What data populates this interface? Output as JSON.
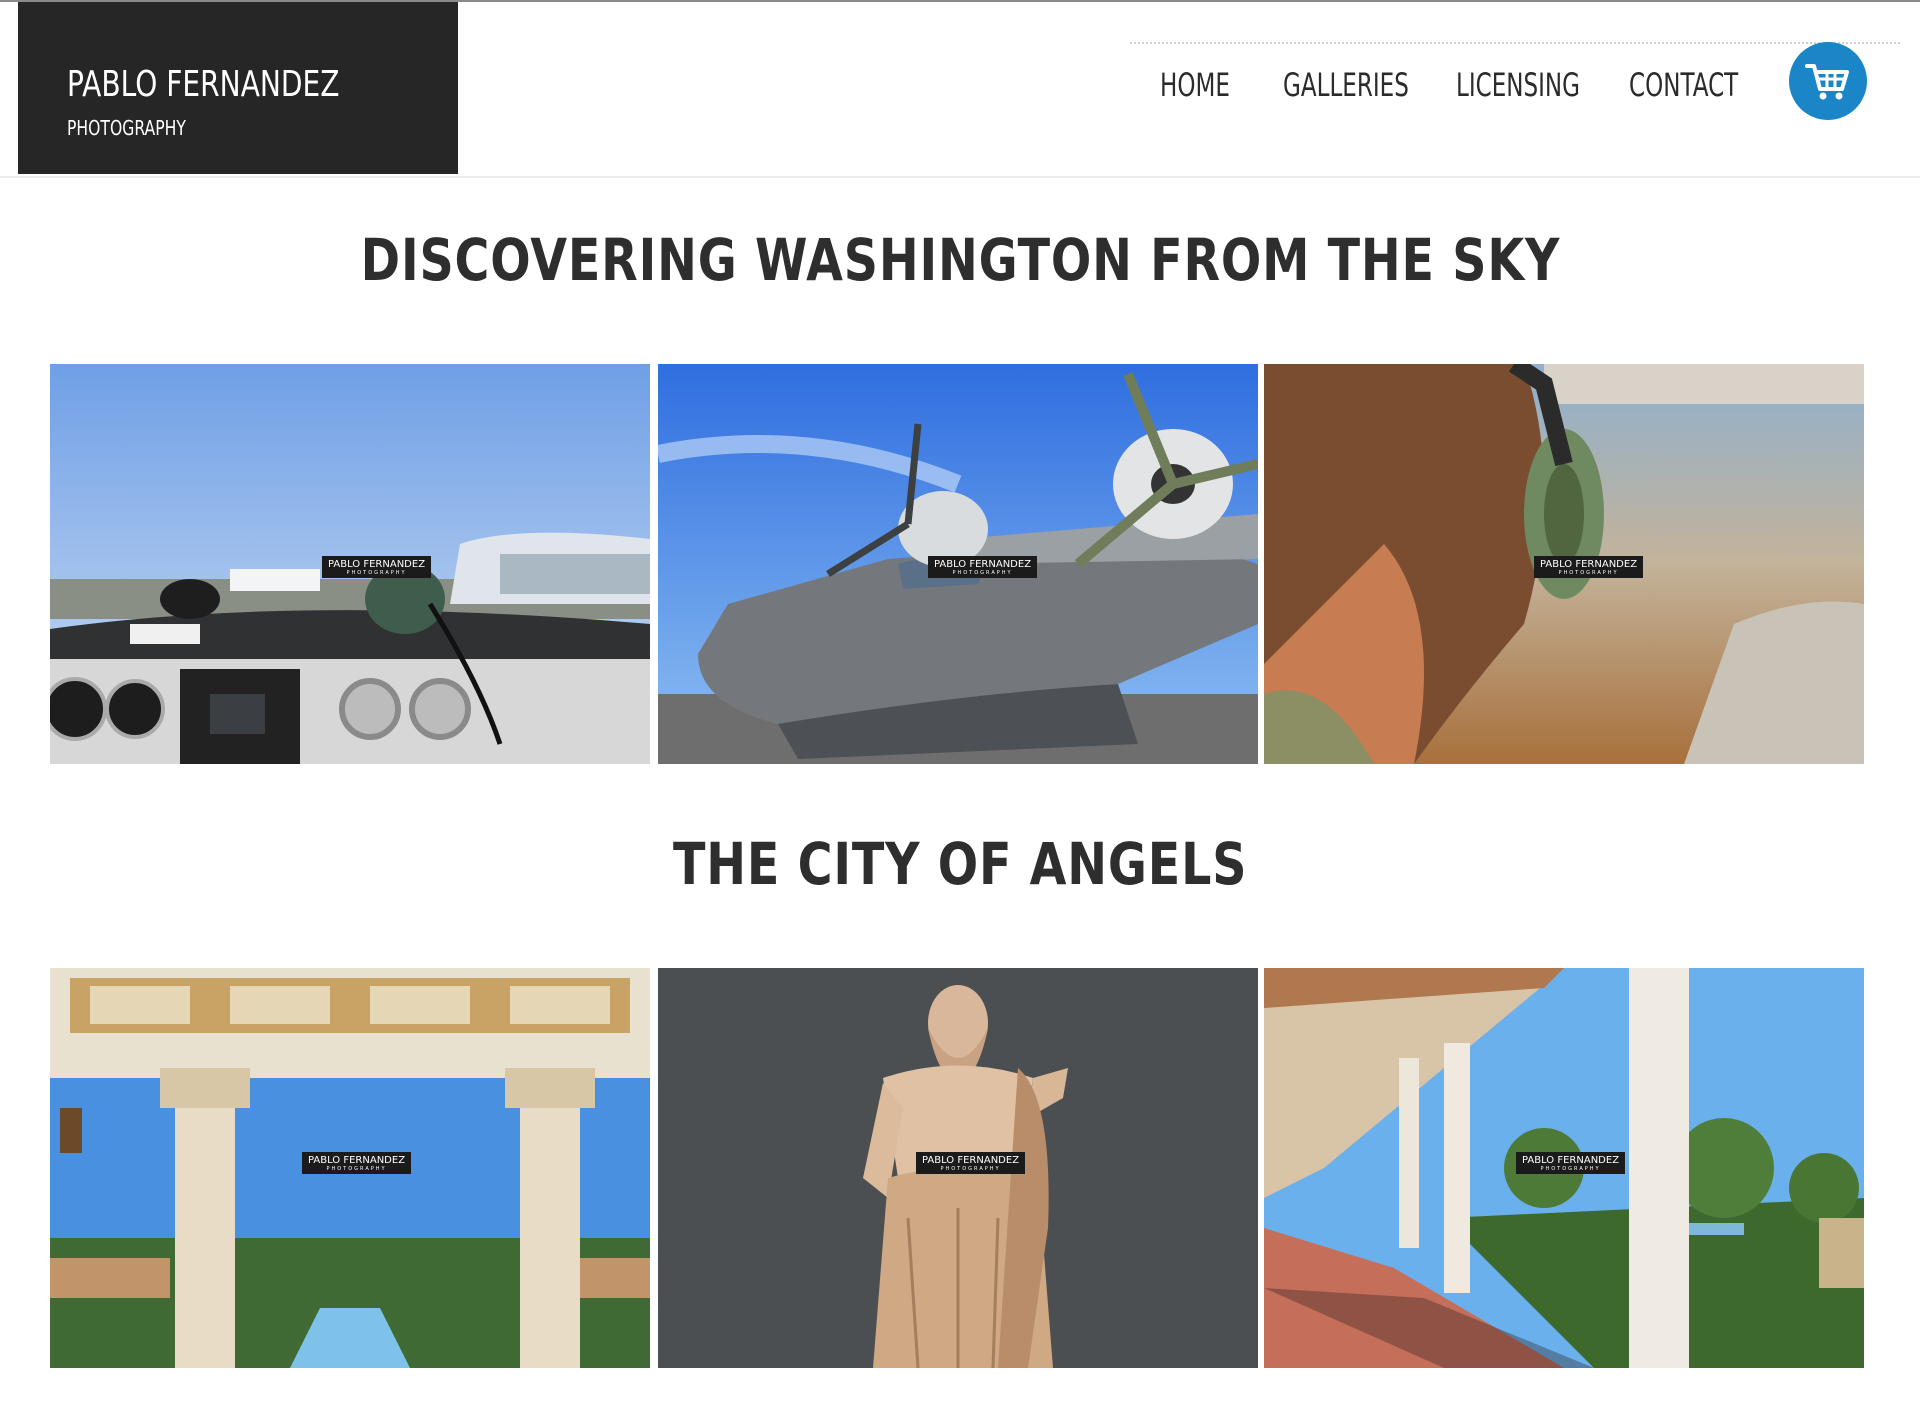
{
  "header": {
    "logo": {
      "name": "PABLO FERNANDEZ",
      "subtitle": "PHOTOGRAPHY"
    },
    "nav": [
      {
        "label": "HOME"
      },
      {
        "label": "GALLERIES"
      },
      {
        "label": "LICENSING"
      },
      {
        "label": "CONTACT"
      }
    ],
    "cart_icon": "shopping-cart-icon",
    "cart_color": "#1a86c8"
  },
  "sections": [
    {
      "title": "DISCOVERING WASHINGTON FROM THE SKY",
      "photos": [
        {
          "subject": "cockpit-dashboard-headset",
          "watermark": "PABLO FERNANDEZ",
          "watermark_sub": "PHOTOGRAPHY"
        },
        {
          "subject": "vintage-seaplane",
          "watermark": "PABLO FERNANDEZ",
          "watermark_sub": "PHOTOGRAPHY"
        },
        {
          "subject": "pilot-with-headset",
          "watermark": "PABLO FERNANDEZ",
          "watermark_sub": "PHOTOGRAPHY"
        }
      ]
    },
    {
      "title": "THE CITY OF ANGELS",
      "photos": [
        {
          "subject": "columns-garden-pool",
          "watermark": "PABLO FERNANDEZ",
          "watermark_sub": "PHOTOGRAPHY"
        },
        {
          "subject": "marble-statue",
          "watermark": "PABLO FERNANDEZ",
          "watermark_sub": "PHOTOGRAPHY"
        },
        {
          "subject": "colonnade-garden",
          "watermark": "PABLO FERNANDEZ",
          "watermark_sub": "PHOTOGRAPHY"
        }
      ]
    }
  ]
}
